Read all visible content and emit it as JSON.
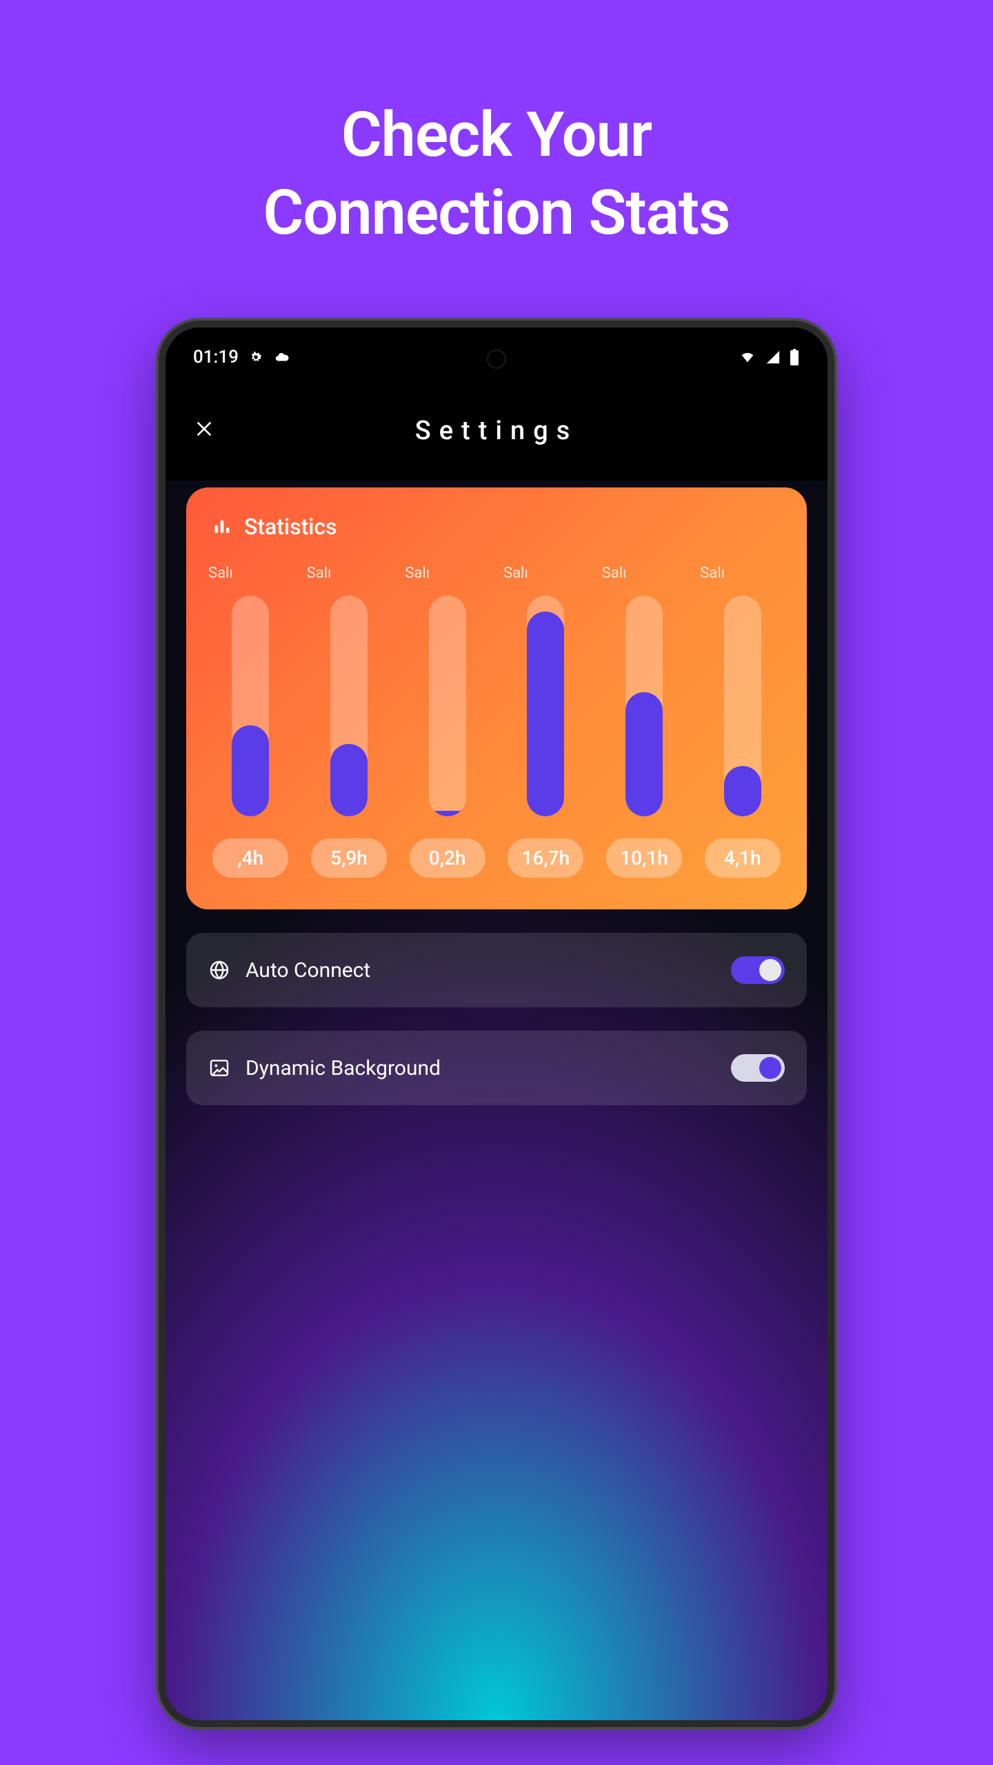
{
  "promo": {
    "title": "Check Your\nConnection Stats"
  },
  "status": {
    "time": "01:19"
  },
  "header": {
    "title": "Settings"
  },
  "stats": {
    "title": "Statistics",
    "days": [
      {
        "label": "Salı",
        "hours": ",4h"
      },
      {
        "label": "Salı",
        "hours": "5,9h"
      },
      {
        "label": "Salı",
        "hours": "0,2h"
      },
      {
        "label": "Salı",
        "hours": "16,7h"
      },
      {
        "label": "Salı",
        "hours": "10,1h"
      },
      {
        "label": "Salı",
        "hours": "4,1h"
      }
    ]
  },
  "settings": {
    "autoConnect": {
      "label": "Auto Connect",
      "on": true
    },
    "dynamicBackground": {
      "label": "Dynamic Background",
      "on": true
    }
  },
  "chart_data": {
    "type": "bar",
    "categories": [
      "Salı",
      "Salı",
      "Salı",
      "Salı",
      "Salı",
      "Salı"
    ],
    "values": [
      7.4,
      5.9,
      0.2,
      16.7,
      10.1,
      4.1
    ],
    "value_labels": [
      ",4h",
      "5,9h",
      "0,2h",
      "16,7h",
      "10,1h",
      "4,1h"
    ],
    "title": "Statistics",
    "xlabel": "",
    "ylabel": "hours",
    "ylim": [
      0,
      18
    ]
  }
}
